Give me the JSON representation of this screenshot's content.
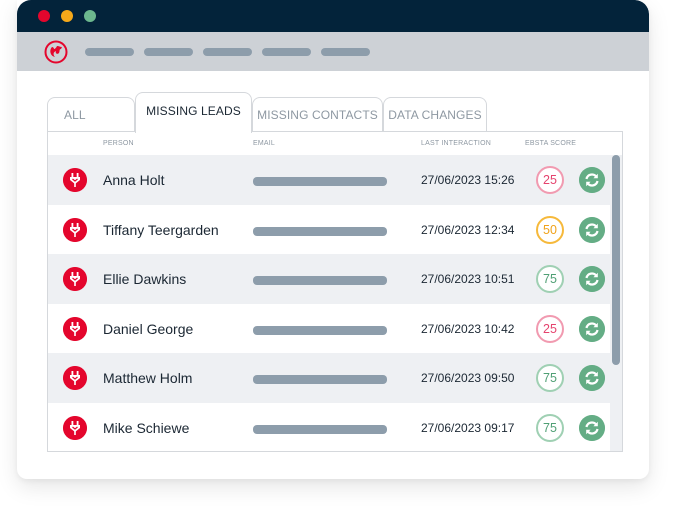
{
  "window": {
    "controls": [
      "close",
      "minimize",
      "maximize"
    ],
    "colors": {
      "titlebar": "#03233a",
      "close": "#e4062d",
      "minimize": "#f6a91a",
      "maximize": "#6cb88e"
    }
  },
  "navbar": {
    "logo_icon": "ebsta-logo-icon",
    "nav_placeholders": 5
  },
  "tabs": [
    {
      "label": "ALL",
      "active": false
    },
    {
      "label": "MISSING LEADS",
      "active": true
    },
    {
      "label": "MISSING CONTACTS",
      "active": false
    },
    {
      "label": "DATA CHANGES",
      "active": false
    }
  ],
  "table": {
    "columns": {
      "person": "PERSON",
      "email": "EMAIL",
      "last_interaction": "LAST INTERACTION",
      "score": "EBSTA SCORE"
    },
    "rows": [
      {
        "name": "Anna Holt",
        "last_interaction": "27/06/2023 15:26",
        "score": "25",
        "score_level": "low"
      },
      {
        "name": "Tiffany Teergarden",
        "last_interaction": "27/06/2023 12:34",
        "score": "50",
        "score_level": "mid"
      },
      {
        "name": "Ellie Dawkins",
        "last_interaction": "27/06/2023 10:51",
        "score": "75",
        "score_level": "high"
      },
      {
        "name": "Daniel George",
        "last_interaction": "27/06/2023 10:42",
        "score": "25",
        "score_level": "low"
      },
      {
        "name": "Matthew Holm",
        "last_interaction": "27/06/2023 09:50",
        "score": "75",
        "score_level": "high"
      },
      {
        "name": "Mike Schiewe",
        "last_interaction": "27/06/2023 09:17",
        "score": "75",
        "score_level": "high"
      }
    ],
    "row_icon": "plug-icon",
    "action_icon": "sync-icon"
  },
  "score_colors": {
    "low": {
      "border": "#f19ab0",
      "text": "#e5436e"
    },
    "mid": {
      "border": "#f6b93b",
      "text": "#f0a21a"
    },
    "high": {
      "border": "#9fd0b3",
      "text": "#4f9f74"
    }
  },
  "accent": "#e4062d",
  "sync_color": "#64ad85"
}
